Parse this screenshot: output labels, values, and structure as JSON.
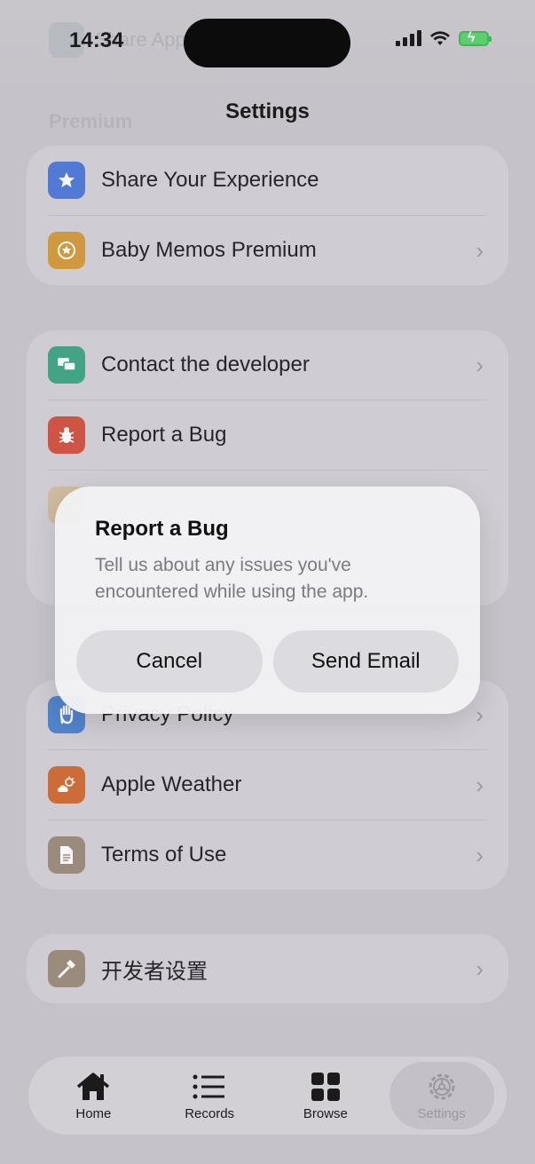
{
  "status": {
    "time": "14:34"
  },
  "header": {
    "title": "Settings",
    "ghost_section": "Premium",
    "ghost_row": "Share App"
  },
  "groups": {
    "premium": [
      {
        "label": "Share Your Experience",
        "icon": "star-icon",
        "color": "#4a78d9",
        "chevron": false
      },
      {
        "label": "Baby Memos Premium",
        "icon": "star-badge-icon",
        "color": "#d49a35",
        "chevron": true
      }
    ],
    "support": [
      {
        "label": "Contact the developer",
        "icon": "chat-bubbles-icon",
        "color": "#3aa583",
        "chevron": true
      },
      {
        "label": "Report a Bug",
        "icon": "bug-icon",
        "color": "#d24f3c",
        "chevron": false
      }
    ],
    "about": [
      {
        "label": "Privacy Policy",
        "icon": "hand-icon",
        "color": "#4a83cf",
        "chevron": true
      },
      {
        "label": "Apple Weather",
        "icon": "weather-icon",
        "color": "#d06a30",
        "chevron": true
      },
      {
        "label": "Terms of Use",
        "icon": "document-icon",
        "color": "#9b8a7a",
        "chevron": true
      }
    ],
    "developer": [
      {
        "label": "开发者设置",
        "icon": "hammer-icon",
        "color": "#9b8a7a",
        "chevron": true
      }
    ]
  },
  "dialog": {
    "title": "Report a Bug",
    "message": "Tell us about any issues you've encountered while using the app.",
    "cancel_label": "Cancel",
    "confirm_label": "Send Email"
  },
  "tabbar": {
    "tabs": [
      {
        "label": "Home",
        "icon": "house-icon",
        "active": false
      },
      {
        "label": "Records",
        "icon": "list-icon",
        "active": false
      },
      {
        "label": "Browse",
        "icon": "grid-icon",
        "active": false
      },
      {
        "label": "Settings",
        "icon": "gear-icon",
        "active": true
      }
    ]
  }
}
